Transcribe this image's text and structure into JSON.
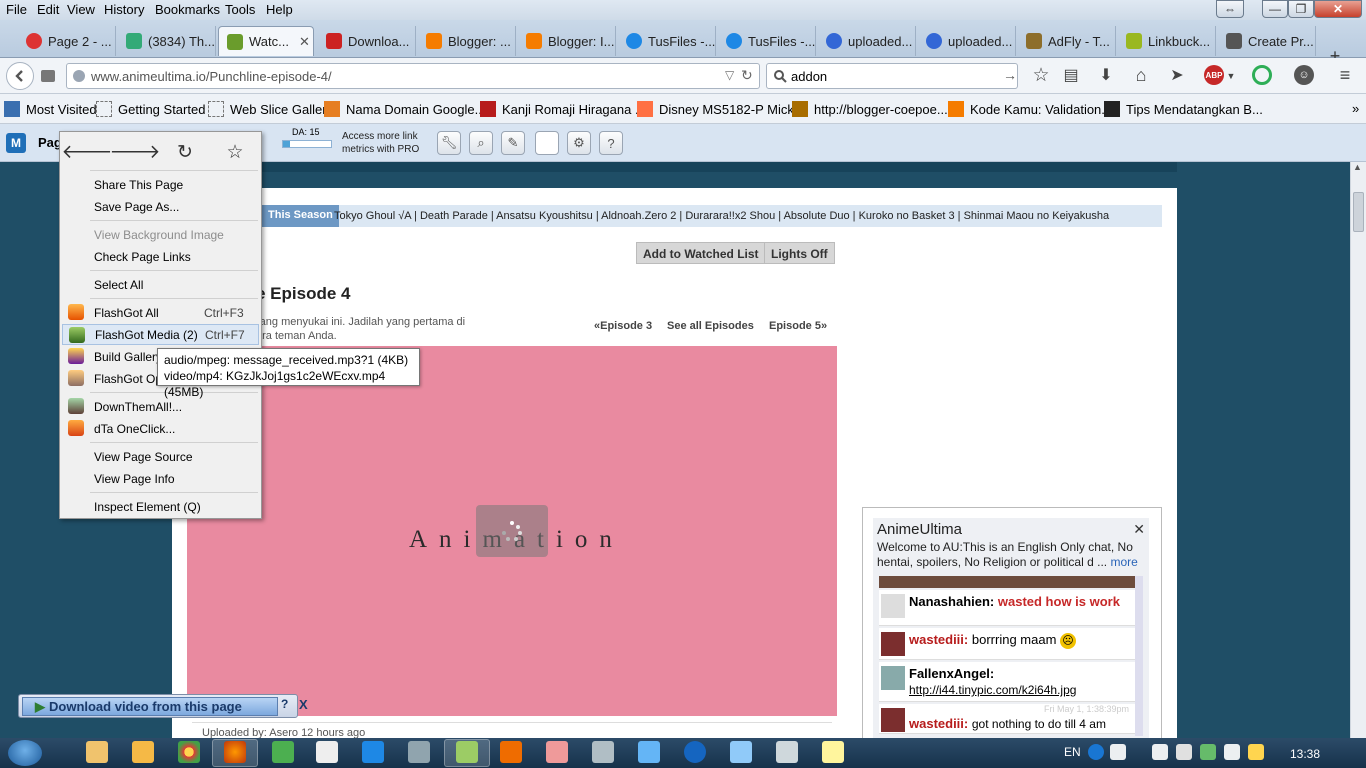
{
  "menubar": {
    "items": [
      "File",
      "Edit",
      "View",
      "History",
      "Bookmarks",
      "Tools",
      "Help"
    ]
  },
  "tabs": [
    {
      "label": "Page 2 - ...",
      "color": "#d33"
    },
    {
      "label": "(3834) Th...",
      "color": "#3a7"
    },
    {
      "label": "Watc...",
      "color": "#6a9c2c"
    },
    {
      "label": "Downloa...",
      "color": "#c22"
    },
    {
      "label": "Blogger: ...",
      "color": "#f57c00"
    },
    {
      "label": "Blogger: I...",
      "color": "#f57c00"
    },
    {
      "label": "TusFiles -...",
      "color": "#1e88e5"
    },
    {
      "label": "TusFiles -...",
      "color": "#1e88e5"
    },
    {
      "label": "uploaded...",
      "color": "#3367d6"
    },
    {
      "label": "uploaded...",
      "color": "#3367d6"
    },
    {
      "label": "AdFly - T...",
      "color": "#8d6e2b"
    },
    {
      "label": "Linkbuck...",
      "color": "#9ab820"
    },
    {
      "label": "Create Pr...",
      "color": "#555"
    }
  ],
  "tab_close": "✕",
  "new_tab": "+",
  "navbar": {
    "url": "www.animeultima.io/Punchline-episode-4/",
    "search_value": "addon"
  },
  "bookmarks": [
    {
      "label": "Most Visited",
      "color": "#3a6fb0"
    },
    {
      "label": "Getting Started",
      "color": "#777"
    },
    {
      "label": "Web Slice Gallery",
      "color": "#777"
    },
    {
      "label": "Nama Domain Google...",
      "color": "#e67e22"
    },
    {
      "label": "Kanji Romaji Hiragana ...",
      "color": "#b71c1c"
    },
    {
      "label": "Disney MS5182-P Mick...",
      "color": "#ff7043"
    },
    {
      "label": "http://blogger-coepoe...",
      "color": "#a86d00"
    },
    {
      "label": "Kode Kamu: Validation...",
      "color": "#f57c00"
    },
    {
      "label": "Tips Mendatangkan B...",
      "color": "#222"
    }
  ],
  "bookmarks_more": "»",
  "mozbar": {
    "page_label": "Page",
    "da": "DA: 15",
    "pro_text_1": "Access more link",
    "pro_text_2": "metrics with PRO"
  },
  "content": {
    "season_label": "This Season",
    "season_links": "Tokyo Ghoul √A | Death Parade | Ansatsu Kyoushitsu | Aldnoah.Zero 2 | Durarara!!x2 Shou | Absolute Duo | Kuroko no Basket 3 | Shinmai Maou no Keiyakusha",
    "watched_btn": "Add to Watched List",
    "lights_btn": "Lights Off",
    "episode_title": "e Episode 4",
    "fb_line1": "rang menyukai ini. Jadilah yang pertama di",
    "fb_line2": "ara teman Anda.",
    "prev_ep": "«Episode 3",
    "all_eps": "See all Episodes",
    "next_ep": "Episode 5»",
    "video_text": "Animation",
    "uploaded": "Uploaded by: Asero 12 hours ago"
  },
  "chat": {
    "title": "AnimeUltima",
    "close": "✕",
    "welcome": "Welcome to AU:This is an English Only chat, No hentai, spoilers, No Religion or political d ...",
    "more": "more",
    "messages": [
      {
        "name": "Nanashahien:",
        "text": "wasted how is work",
        "text_color": "#c62828"
      },
      {
        "name": "wastediii:",
        "text": "borrring maam",
        "text_color": "#222"
      },
      {
        "name": "FallenxAngel:",
        "text": "http://i44.tinypic.com/k2i64h.jpg",
        "text_color": "#222"
      },
      {
        "name": "wastediii:",
        "text": "got nothing to do till 4 am",
        "text_color": "#222"
      }
    ],
    "timestamp": "Fri May 1, 1:38:39pm"
  },
  "download_bar": {
    "label": "Download video from this page",
    "help": "?",
    "close": "X"
  },
  "context_menu": {
    "items": [
      {
        "label": "Share This Page",
        "shortcut": "",
        "disabled": false
      },
      {
        "label": "Save Page As...",
        "shortcut": "",
        "disabled": false
      },
      {
        "label": "View Background Image",
        "shortcut": "",
        "disabled": true
      },
      {
        "label": "Check Page Links",
        "shortcut": "",
        "disabled": false
      },
      {
        "label": "Select All",
        "shortcut": "",
        "disabled": false
      },
      {
        "label": "FlashGot All",
        "shortcut": "Ctrl+F3",
        "disabled": false
      },
      {
        "label": "FlashGot Media (2)",
        "shortcut": "Ctrl+F7",
        "disabled": false
      },
      {
        "label": "Build Gallery...",
        "shortcut": "",
        "disabled": false
      },
      {
        "label": "FlashGot Options",
        "shortcut": "",
        "disabled": false
      },
      {
        "label": "DownThemAll!...",
        "shortcut": "",
        "disabled": false
      },
      {
        "label": "dTa OneClick...",
        "shortcut": "",
        "disabled": false
      },
      {
        "label": "View Page Source",
        "shortcut": "",
        "disabled": false
      },
      {
        "label": "View Page Info",
        "shortcut": "",
        "disabled": false
      },
      {
        "label": "Inspect Element (Q)",
        "shortcut": "",
        "disabled": false
      }
    ]
  },
  "submenu": {
    "line1": "audio/mpeg: message_received.mp3?1 (4KB)",
    "line2": "video/mp4: KGzJkJoj1gs1c2eWEcxv.mp4 (45MB)"
  },
  "taskbar": {
    "lang": "EN",
    "clock": "13:38"
  }
}
